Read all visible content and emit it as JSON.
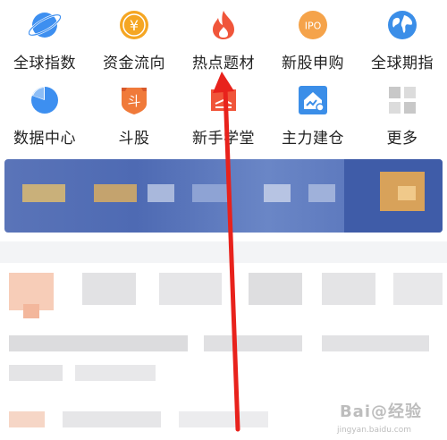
{
  "menu": {
    "row1": [
      {
        "label": "全球指数",
        "icon": "planet-icon",
        "color": "#3d8ff0"
      },
      {
        "label": "资金流向",
        "icon": "yen-coin-icon",
        "color": "#f5a623"
      },
      {
        "label": "热点题材",
        "icon": "flame-icon",
        "color": "#f0553a"
      },
      {
        "label": "新股申购",
        "icon": "ipo-icon",
        "color": "#f5a34a"
      },
      {
        "label": "全球期指",
        "icon": "globe-icon",
        "color": "#3b8ee8"
      }
    ],
    "row2": [
      {
        "label": "数据中心",
        "icon": "pie-chart-icon",
        "color": "#3d8ff0"
      },
      {
        "label": "斗股",
        "icon": "dou-shield-icon",
        "glyph": "斗",
        "color": "#f07a3a"
      },
      {
        "label": "新手学堂",
        "icon": "graduation-cap-icon",
        "color": "#f0553a"
      },
      {
        "label": "主力建仓",
        "icon": "house-chart-icon",
        "color": "#3b8ee8"
      },
      {
        "label": "更多",
        "icon": "grid-more-icon",
        "color": "#c8c8c8"
      }
    ]
  },
  "icons": {
    "yen": "¥",
    "ipo": "IPO"
  },
  "watermark": {
    "text": "Bai@经验",
    "sub": "jingyan.baidu.com"
  }
}
